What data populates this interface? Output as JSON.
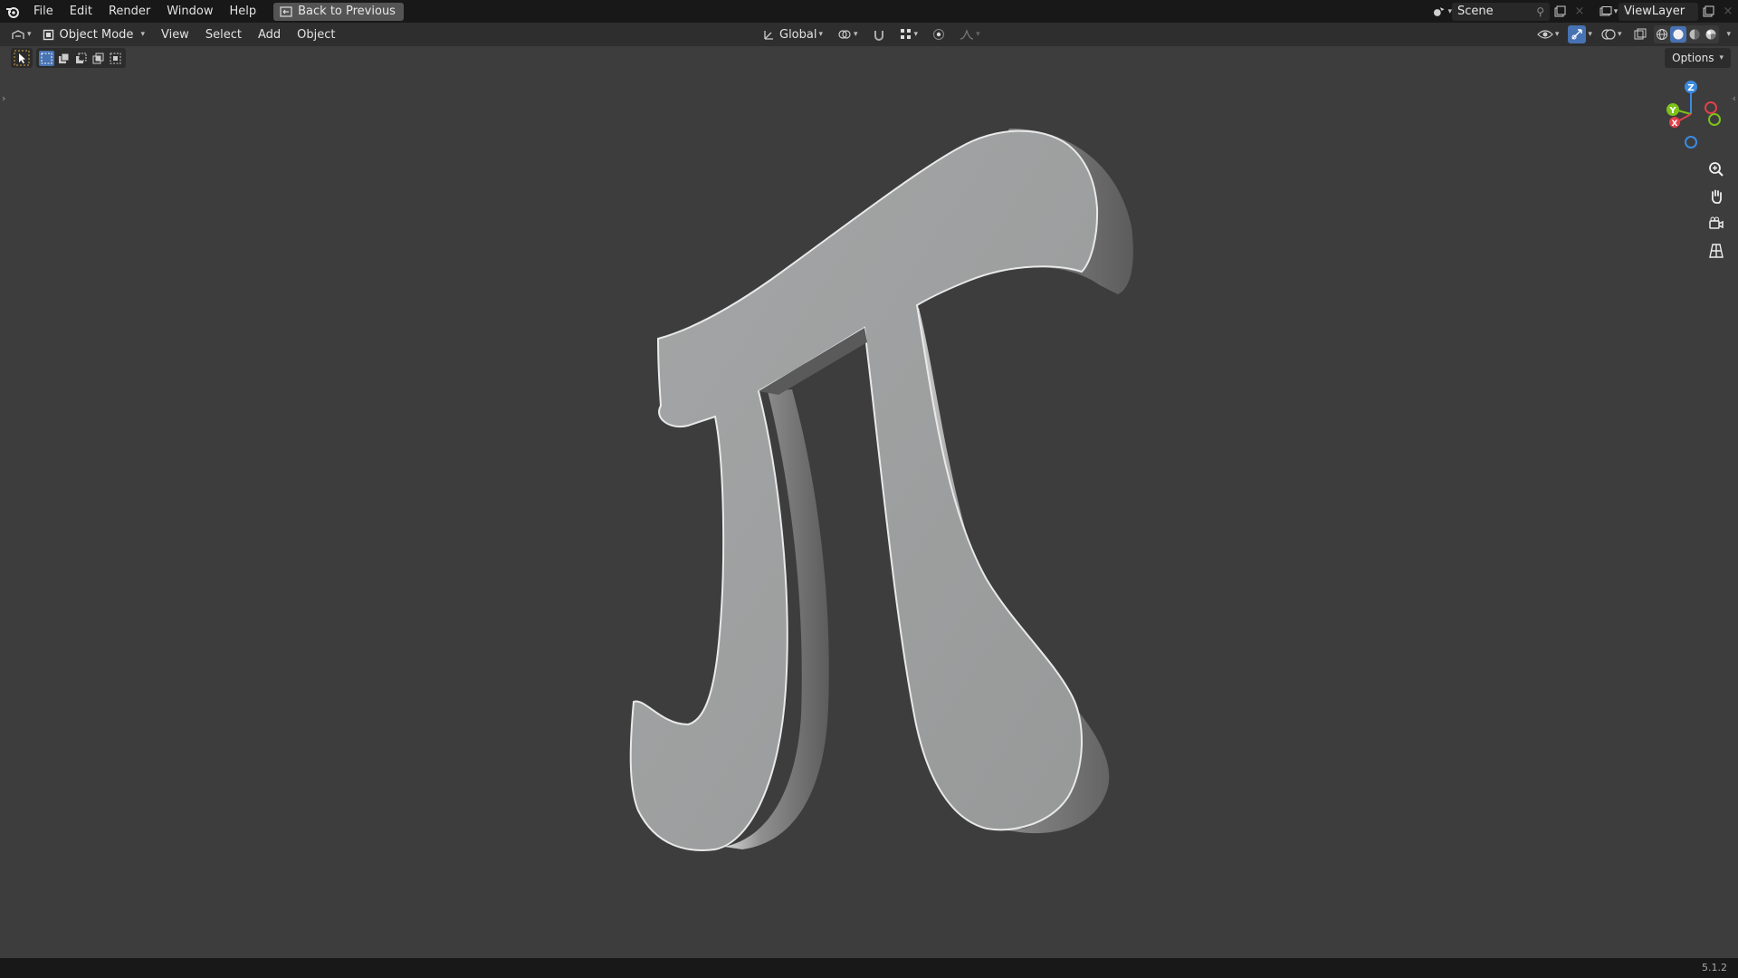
{
  "menu": {
    "file": "File",
    "edit": "Edit",
    "render": "Render",
    "window": "Window",
    "help": "Help",
    "back_button": "Back to Previous"
  },
  "scene": {
    "label": "Scene"
  },
  "view_layer": {
    "label": "ViewLayer"
  },
  "header": {
    "mode": "Object Mode",
    "view": "View",
    "select": "Select",
    "add": "Add",
    "object": "Object",
    "orientation": "Global",
    "options": "Options"
  },
  "gizmo": {
    "z": "Z",
    "y": "Y",
    "x": "X"
  },
  "status": {
    "version": "5.1.2"
  },
  "colors": {
    "accent": "#4772b3",
    "viewport_bg": "#3d3d3d",
    "axis_x": "#e0414b",
    "axis_y": "#7cc21a",
    "axis_z": "#3b8ae0"
  },
  "icons": [
    "blender-logo-icon",
    "back-icon",
    "editor-type-icon",
    "object-mode-icon",
    "transform-orientation-icon",
    "pivot-icon",
    "snap-icon",
    "snap-target-icon",
    "proportional-edit-icon",
    "falloff-icon",
    "visibility-icon",
    "gizmo-icon",
    "overlay-icon",
    "xray-icon",
    "wireframe-icon",
    "solid-icon",
    "material-icon",
    "rendered-icon",
    "zoom-icon",
    "pan-hand-icon",
    "camera-icon",
    "grid-icon"
  ]
}
